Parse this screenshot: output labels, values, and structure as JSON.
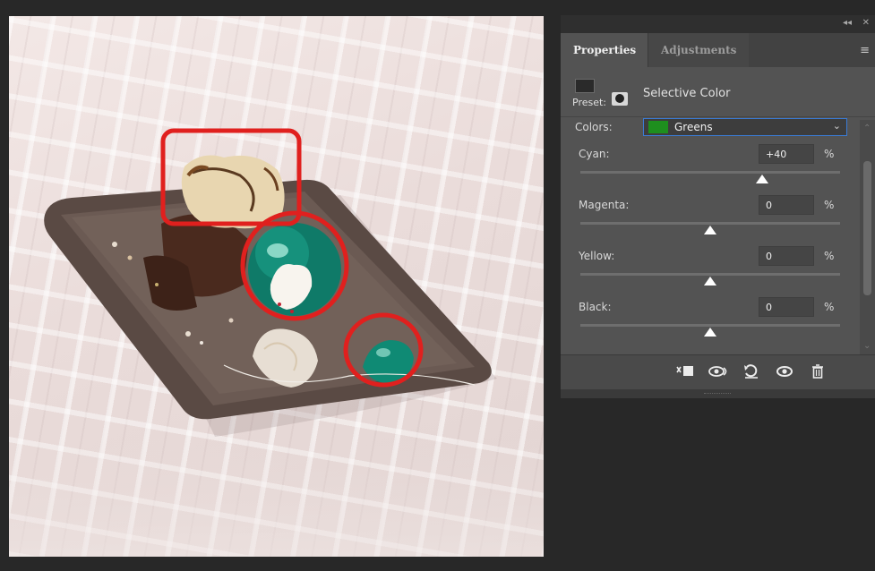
{
  "panel": {
    "collapse_glyph": "◂◂",
    "close_glyph": "✕",
    "tabs": [
      {
        "label": "Properties",
        "active": true
      },
      {
        "label": "Adjustments",
        "active": false
      }
    ],
    "menu_glyph": "≡",
    "preset_label": "Preset:",
    "adjustment_title": "Selective Color",
    "colors_label": "Colors:",
    "colors_value": "Greens",
    "colors_swatch": "#1e8f1e",
    "chevron_glyph": "⌄",
    "sliders": [
      {
        "label": "Cyan:",
        "value": "+40",
        "unit": "%",
        "fraction": 0.7
      },
      {
        "label": "Magenta:",
        "value": "0",
        "unit": "%",
        "fraction": 0.5
      },
      {
        "label": "Yellow:",
        "value": "0",
        "unit": "%",
        "fraction": 0.5
      },
      {
        "label": "Black:",
        "value": "0",
        "unit": "%",
        "fraction": 0.5
      }
    ],
    "bottom_icons": [
      "clip-to-layer-icon",
      "view-previous-state-icon",
      "reset-icon",
      "visibility-icon",
      "delete-icon"
    ],
    "scroll_up_glyph": "⌃",
    "scroll_down_glyph": "⌄"
  },
  "canvas": {
    "highlight_color": "#e0201e",
    "subject": "dessert plate with green spheres"
  }
}
